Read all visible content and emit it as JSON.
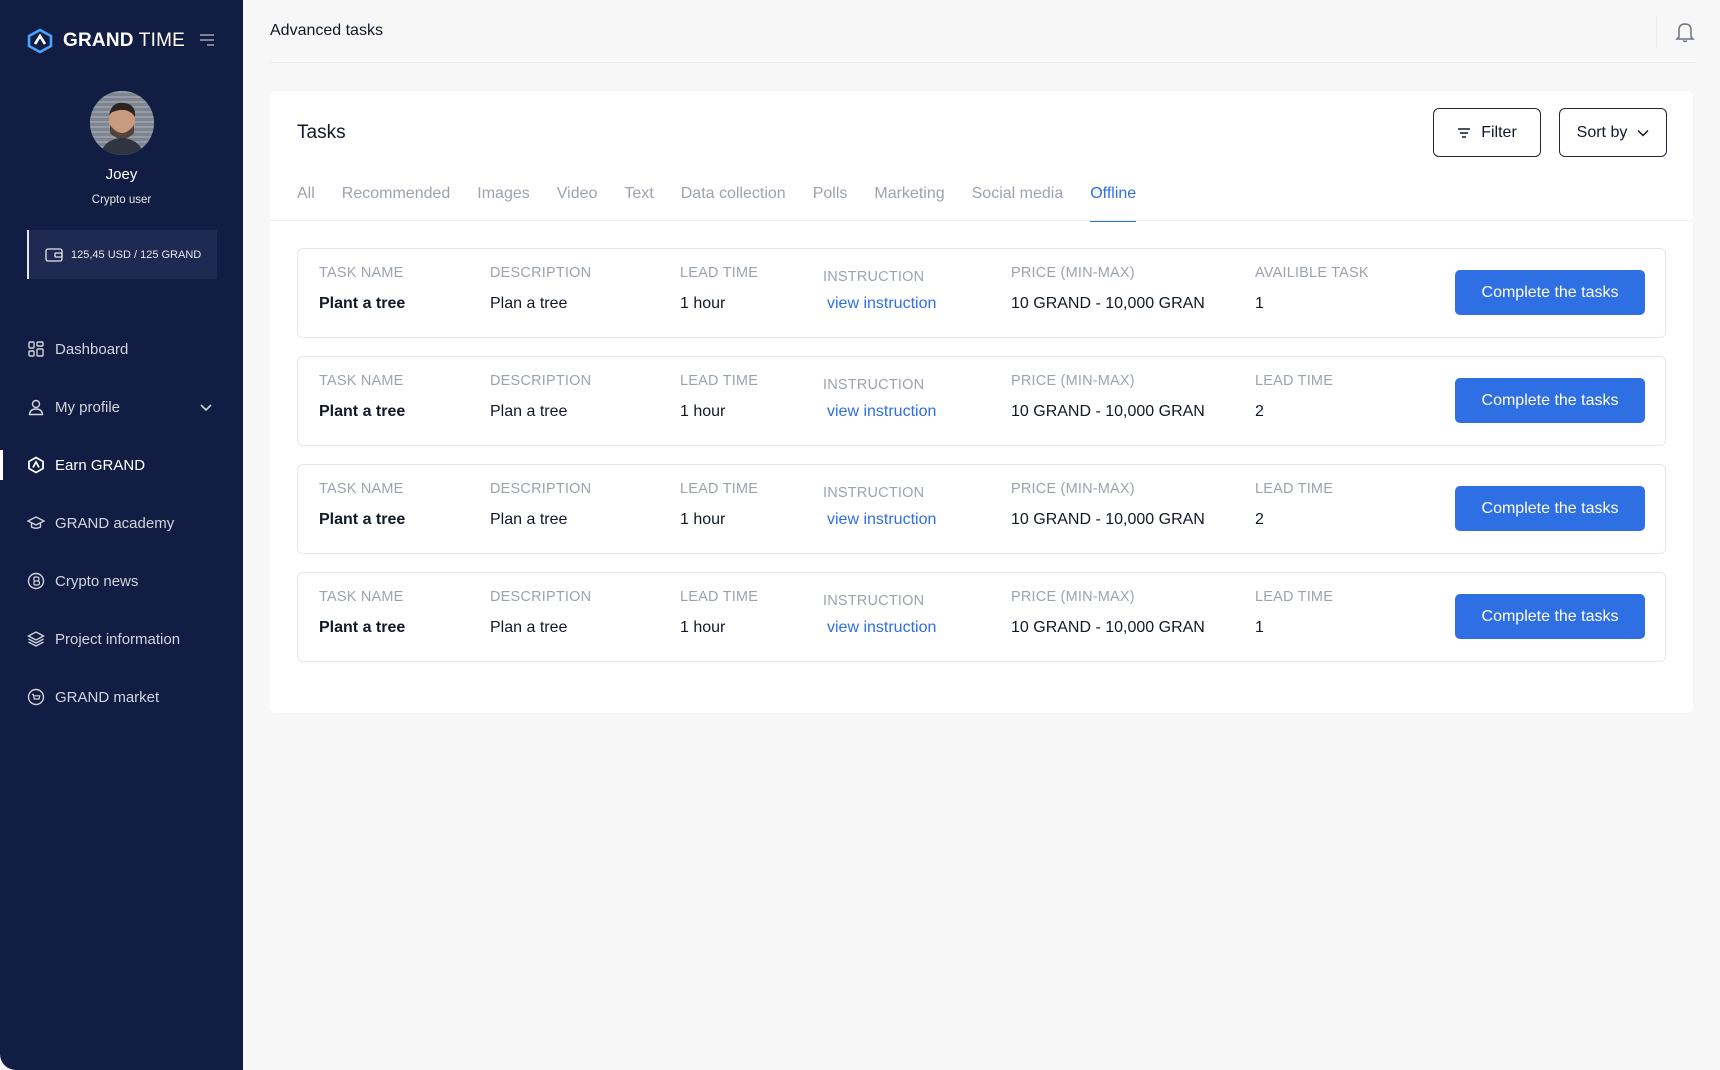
{
  "app": {
    "logo_bold": "GRAND",
    "logo_light": " TIME",
    "brand_color": "#121d44",
    "accent_color": "#2f6fe4"
  },
  "user": {
    "name": "Joey",
    "role": "Crypto user",
    "wallet": "125,45 USD / 125 GRAND"
  },
  "sidebar": {
    "items": [
      {
        "label": "Dashboard",
        "icon": "dashboard-icon"
      },
      {
        "label": "My profile",
        "icon": "user-icon"
      },
      {
        "label": "Earn GRAND",
        "icon": "grand-logo-icon",
        "active": true
      },
      {
        "label": "GRAND academy",
        "icon": "graduation-cap-icon"
      },
      {
        "label": "Crypto news",
        "icon": "bitcoin-icon"
      },
      {
        "label": "Project information",
        "icon": "layers-icon"
      },
      {
        "label": "GRAND market",
        "icon": "market-icon"
      }
    ]
  },
  "header": {
    "title": "Advanced tasks"
  },
  "card": {
    "title": "Tasks",
    "filter_label": "Filter",
    "sort_label": "Sort by",
    "tabs": [
      "All",
      "Recommended",
      "Images",
      "Video",
      "Text",
      "Data collection",
      "Polls",
      "Marketing",
      "Social media",
      "Offline"
    ],
    "active_tab": "Offline"
  },
  "tasks": [
    {
      "h_name": "TASK NAME",
      "name": "Plant a tree",
      "h_desc": "DESCRIPTION",
      "desc": "Plan a tree",
      "h_lead": "LEAD TIME",
      "lead": "1 hour",
      "h_instr": "INSTRUCTION",
      "instr": "view instruction",
      "h_price": "PRICE (MIN-MAX)",
      "price": "10 GRAND - 10,000 GRAN",
      "h_last": "AVAILIBLE TASK",
      "last": "1",
      "button": "Complete the tasks"
    },
    {
      "h_name": "TASK NAME",
      "name": "Plant a tree",
      "h_desc": "DESCRIPTION",
      "desc": "Plan a tree",
      "h_lead": "LEAD TIME",
      "lead": "1 hour",
      "h_instr": "INSTRUCTION",
      "instr": "view instruction",
      "h_price": "PRICE (MIN-MAX)",
      "price": "10 GRAND - 10,000 GRAN",
      "h_last": "LEAD TIME",
      "last": "2",
      "button": "Complete the tasks"
    },
    {
      "h_name": "TASK NAME",
      "name": "Plant a tree",
      "h_desc": "DESCRIPTION",
      "desc": "Plan a tree",
      "h_lead": "LEAD TIME",
      "lead": "1 hour",
      "h_instr": "INSTRUCTION",
      "instr": "view instruction",
      "h_price": "PRICE (MIN-MAX)",
      "price": "10 GRAND - 10,000 GRAN",
      "h_last": "LEAD TIME",
      "last": "2",
      "button": "Complete the tasks"
    },
    {
      "h_name": "TASK NAME",
      "name": "Plant a tree",
      "h_desc": "DESCRIPTION",
      "desc": "Plan a tree",
      "h_lead": "LEAD TIME",
      "lead": "1 hour",
      "h_instr": "INSTRUCTION",
      "instr": "view instruction",
      "h_price": "PRICE (MIN-MAX)",
      "price": "10 GRAND - 10,000 GRAN",
      "h_last": "LEAD TIME",
      "last": "1",
      "button": "Complete the tasks"
    }
  ]
}
